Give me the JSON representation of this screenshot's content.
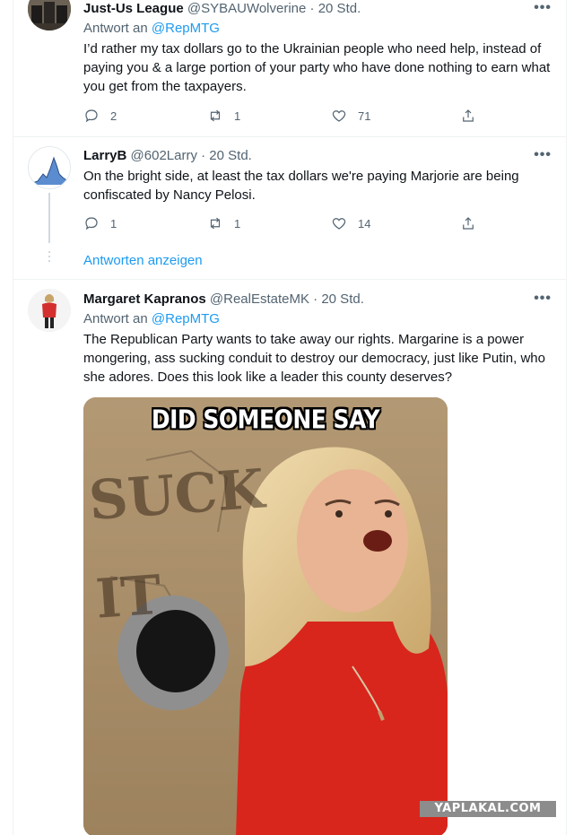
{
  "tweets": [
    {
      "name": "Just-Us League",
      "handle": "@SYBAUWolverine",
      "time": "· 20 Std.",
      "reply_prefix": "Antwort an",
      "reply_target": "@RepMTG",
      "text": "I’d rather my tax dollars go to the Ukrainian people who need help, instead of paying you & a large portion of your party who have done nothing to earn what you get from the taxpayers.",
      "replies": "2",
      "retweets": "1",
      "likes": "71",
      "more": "•••"
    },
    {
      "name": "LarryB",
      "handle": "@602Larry",
      "time": "· 20 Std.",
      "text": "On the bright side, at least the tax dollars we're paying Marjorie are being confiscated by Nancy Pelosi.",
      "replies": "1",
      "retweets": "1",
      "likes": "14",
      "more": "•••"
    },
    {
      "name": "Margaret Kapranos",
      "handle": "@RealEstateMK",
      "time": "· 20 Std.",
      "reply_prefix": "Antwort an",
      "reply_target": "@RepMTG",
      "text": "The Republican Party wants to take away our rights. Margarine is a power mongering, ass sucking conduit to destroy our democracy, just like Putin, who she adores. Does this look like a leader this county deserves?",
      "more": "•••",
      "media_caption": "DID SOMEONE SAY",
      "media_wall_text": "SUCK IT"
    }
  ],
  "show_replies": "Antworten anzeigen",
  "watermark": "YAPLAKAL.COM",
  "icons": {
    "reply": "reply-icon",
    "retweet": "retweet-icon",
    "like": "like-icon",
    "share": "share-icon"
  },
  "colors": {
    "accent": "#1d9bf0",
    "secondary_text": "#536471",
    "primary_text": "#0f1419"
  }
}
